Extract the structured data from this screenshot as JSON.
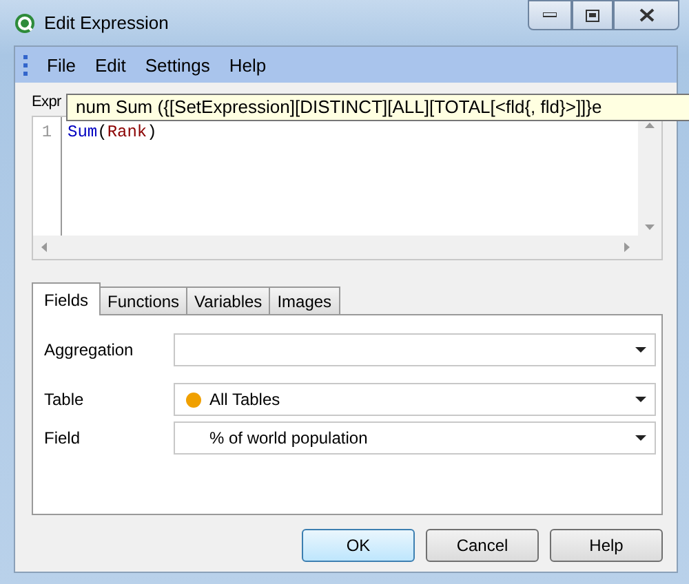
{
  "window": {
    "title": "Edit Expression"
  },
  "menu": [
    "File",
    "Edit",
    "Settings",
    "Help"
  ],
  "expression_label": "Expr",
  "tooltip": {
    "text": "num Sum ({[SetExpression][DISTINCT][ALL][TOTAL[<fld{, fld}>]]}e"
  },
  "editor": {
    "line_numbers": [
      "1"
    ],
    "tokens": [
      {
        "text": "Sum",
        "kind": "function"
      },
      {
        "text": "(",
        "kind": "paren"
      },
      {
        "text": "Rank",
        "kind": "field"
      },
      {
        "text": ")",
        "kind": "paren"
      }
    ]
  },
  "tabs": [
    {
      "label": "Fields",
      "selected": true
    },
    {
      "label": "Functions",
      "selected": false
    },
    {
      "label": "Variables",
      "selected": false
    },
    {
      "label": "Images",
      "selected": false
    }
  ],
  "fields": [
    {
      "label": "Aggregation"
    },
    {
      "label": "Table",
      "value": "All Tables",
      "color": "#f0a000"
    },
    {
      "label": "Field",
      "value": "% of world population"
    }
  ],
  "buttons": [
    {
      "label": "OK",
      "focused": true
    },
    {
      "label": "Cancel",
      "focused": false
    },
    {
      "label": "Help",
      "focused": false
    }
  ]
}
